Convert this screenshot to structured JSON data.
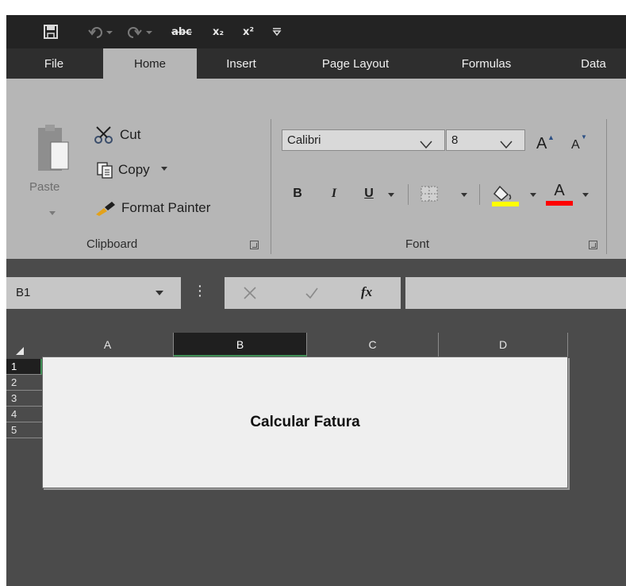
{
  "quick_access": {
    "save_icon": "save-icon",
    "undo_icon": "undo-icon",
    "redo_icon": "redo-icon",
    "strikethrough_label": "abc",
    "subscript_label": "x₂",
    "superscript_label": "x²",
    "customize_icon": "customize-icon"
  },
  "tabs": [
    {
      "label": "File",
      "active": false
    },
    {
      "label": "Home",
      "active": true
    },
    {
      "label": "Insert",
      "active": false
    },
    {
      "label": "Page Layout",
      "active": false
    },
    {
      "label": "Formulas",
      "active": false
    },
    {
      "label": "Data",
      "active": false
    }
  ],
  "clipboard": {
    "paste_label": "Paste",
    "cut_label": "Cut",
    "copy_label": "Copy",
    "format_painter_label": "Format Painter",
    "group_label": "Clipboard"
  },
  "font": {
    "family": "Calibri",
    "size": "8",
    "bold_label": "B",
    "italic_label": "I",
    "underline_label": "U",
    "font_color_label": "A",
    "increase_label": "A",
    "decrease_label": "A",
    "group_label": "Font",
    "fill_color": "#ffff00",
    "text_color": "#ff0000"
  },
  "formula_bar": {
    "name_box": "B1",
    "fx_label": "fx",
    "formula": ""
  },
  "grid": {
    "columns": [
      "A",
      "B",
      "C",
      "D"
    ],
    "selected_column": "B",
    "rows": [
      "1",
      "2",
      "3",
      "4",
      "5"
    ],
    "selected_row": "1"
  },
  "sheet": {
    "title": "Calcular Fatura"
  }
}
